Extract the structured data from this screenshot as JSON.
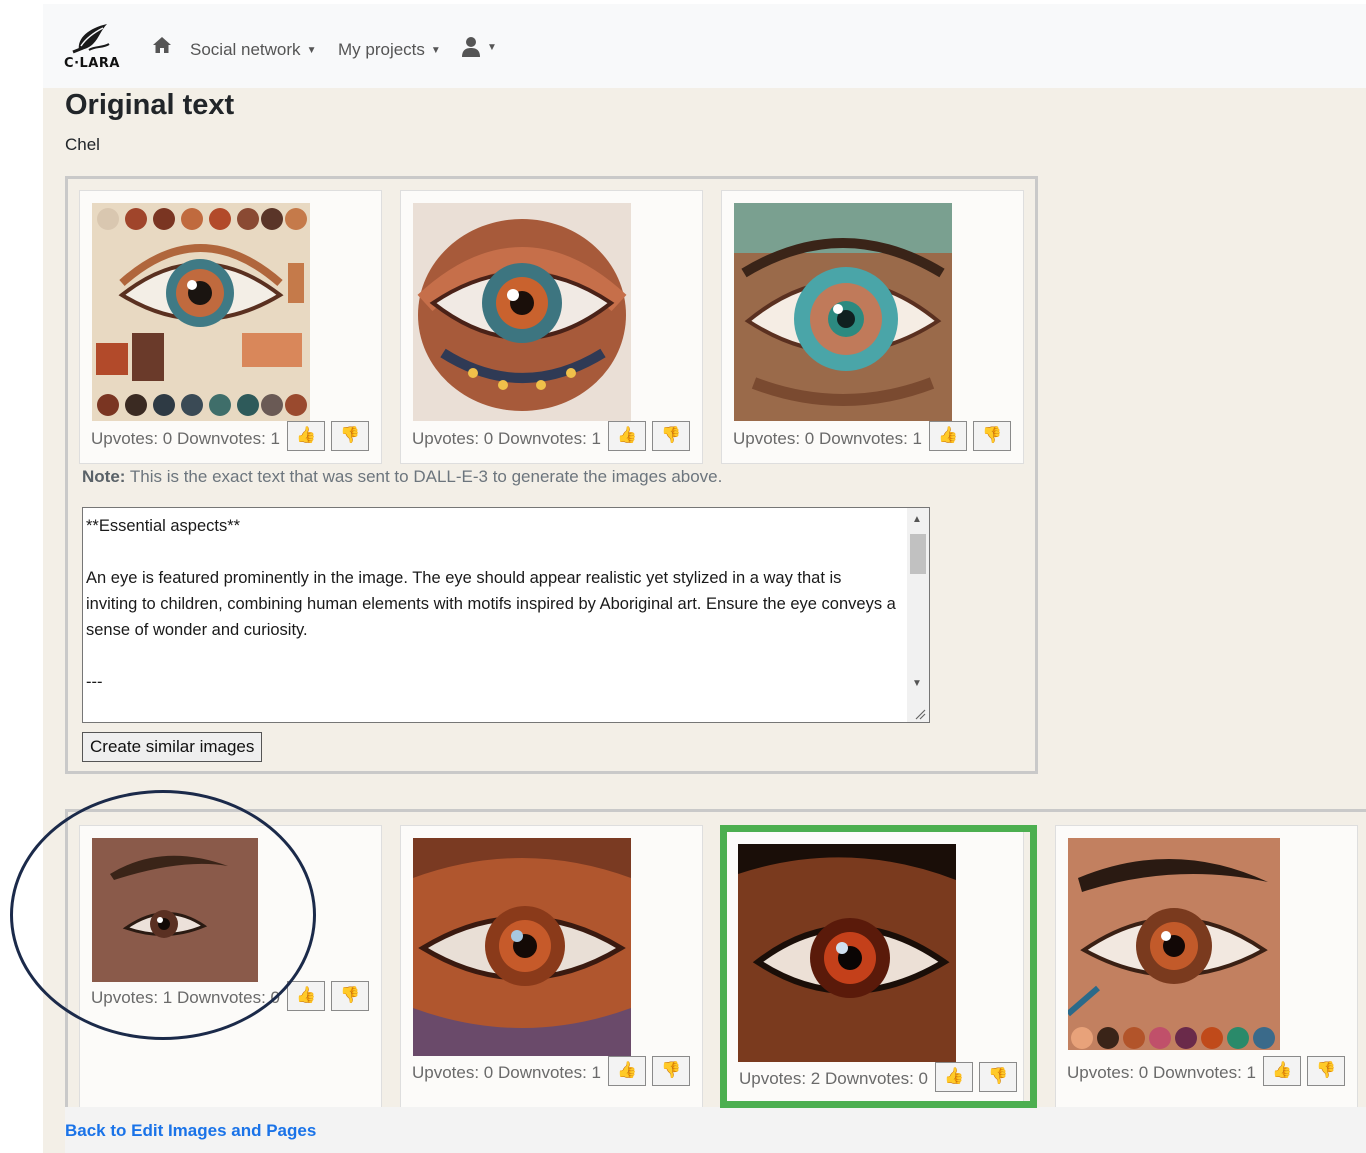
{
  "nav": {
    "logo_text": "C·LARA",
    "items": [
      {
        "label": "Social network"
      },
      {
        "label": "My projects"
      }
    ]
  },
  "page": {
    "title": "Original text",
    "subtitle": "Chel"
  },
  "top_images": [
    {
      "votes": "Upvotes: 0 Downvotes: 1"
    },
    {
      "votes": "Upvotes: 0 Downvotes: 1"
    },
    {
      "votes": "Upvotes: 0 Downvotes: 1"
    }
  ],
  "note": {
    "label": "Note:",
    "text": " This is the exact text that was sent to DALL-E-3 to generate the images above."
  },
  "prompt": {
    "text": "**Essential aspects**\n\nAn eye is featured prominently in the image. The eye should appear realistic yet stylized in a way that is inviting to children, combining human elements with motifs inspired by Aboriginal art. Ensure the eye conveys a sense of wonder and curiosity.\n\n---"
  },
  "create_button": "Create similar images",
  "bottom_images": [
    {
      "votes": "Upvotes: 1 Downvotes: 0"
    },
    {
      "votes": "Upvotes: 0 Downvotes: 1"
    },
    {
      "votes": "Upvotes: 2 Downvotes: 0"
    },
    {
      "votes": "Upvotes: 0 Downvotes: 1"
    }
  ],
  "back_link": "Back to Edit Images and Pages",
  "colors": {
    "highlight_green": "#4caf50",
    "annotation_navy": "#1b2a4a",
    "link_blue": "#1a73e8"
  }
}
